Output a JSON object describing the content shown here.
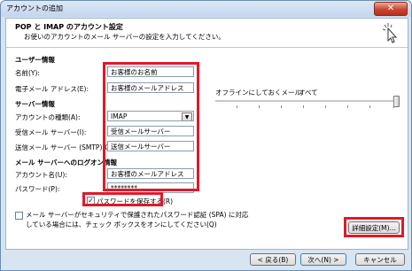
{
  "window": {
    "title": "アカウントの追加",
    "close_glyph": "✕"
  },
  "header": {
    "title": "POP と IMAP のアカウント設定",
    "subtitle": "お使いのアカウントのメール サーバーの設定を入力してください。"
  },
  "user_info": {
    "section": "ユーザー情報",
    "name_label": "名前(Y):",
    "name_value": "お客様のお名前",
    "email_label": "電子メール アドレス(E):",
    "email_value": "お客様のメールアドレス"
  },
  "server_info": {
    "section": "サーバー情報",
    "account_type_label": "アカウントの種類(A):",
    "account_type_value": "IMAP",
    "incoming_label": "受信メール サーバー(I):",
    "incoming_value": "受信メールサーバー",
    "outgoing_label": "送信メール サーバー (SMTP)(O):",
    "outgoing_value": "送信メールサーバー"
  },
  "logon_info": {
    "section": "メール サーバーへのログオン情報",
    "account_name_label": "アカウント名(U):",
    "account_name_value": "お客様のメールアドレス",
    "password_label": "パスワード(P):",
    "password_value": "********",
    "save_password_label": "パスワードを保存する(R)",
    "save_password_checked": true,
    "spa_label_line1": "メール サーバーがセキュリティで保護されたパスワード認証 (SPA) に対応",
    "spa_label_line2": "している場合には、チェック ボックスをオンにしてください(Q)",
    "spa_checked": false
  },
  "offline": {
    "label": "オフラインにしておくメール:",
    "value": "すべて",
    "slider_fraction": 1.0
  },
  "buttons": {
    "more_settings": "詳細設定(M)...",
    "back": "< 戻る(B)",
    "next": "次へ(N) >",
    "cancel": "キャンセル"
  },
  "colors": {
    "highlight": "#e0192a",
    "window_bg": "#d7e4f2"
  }
}
